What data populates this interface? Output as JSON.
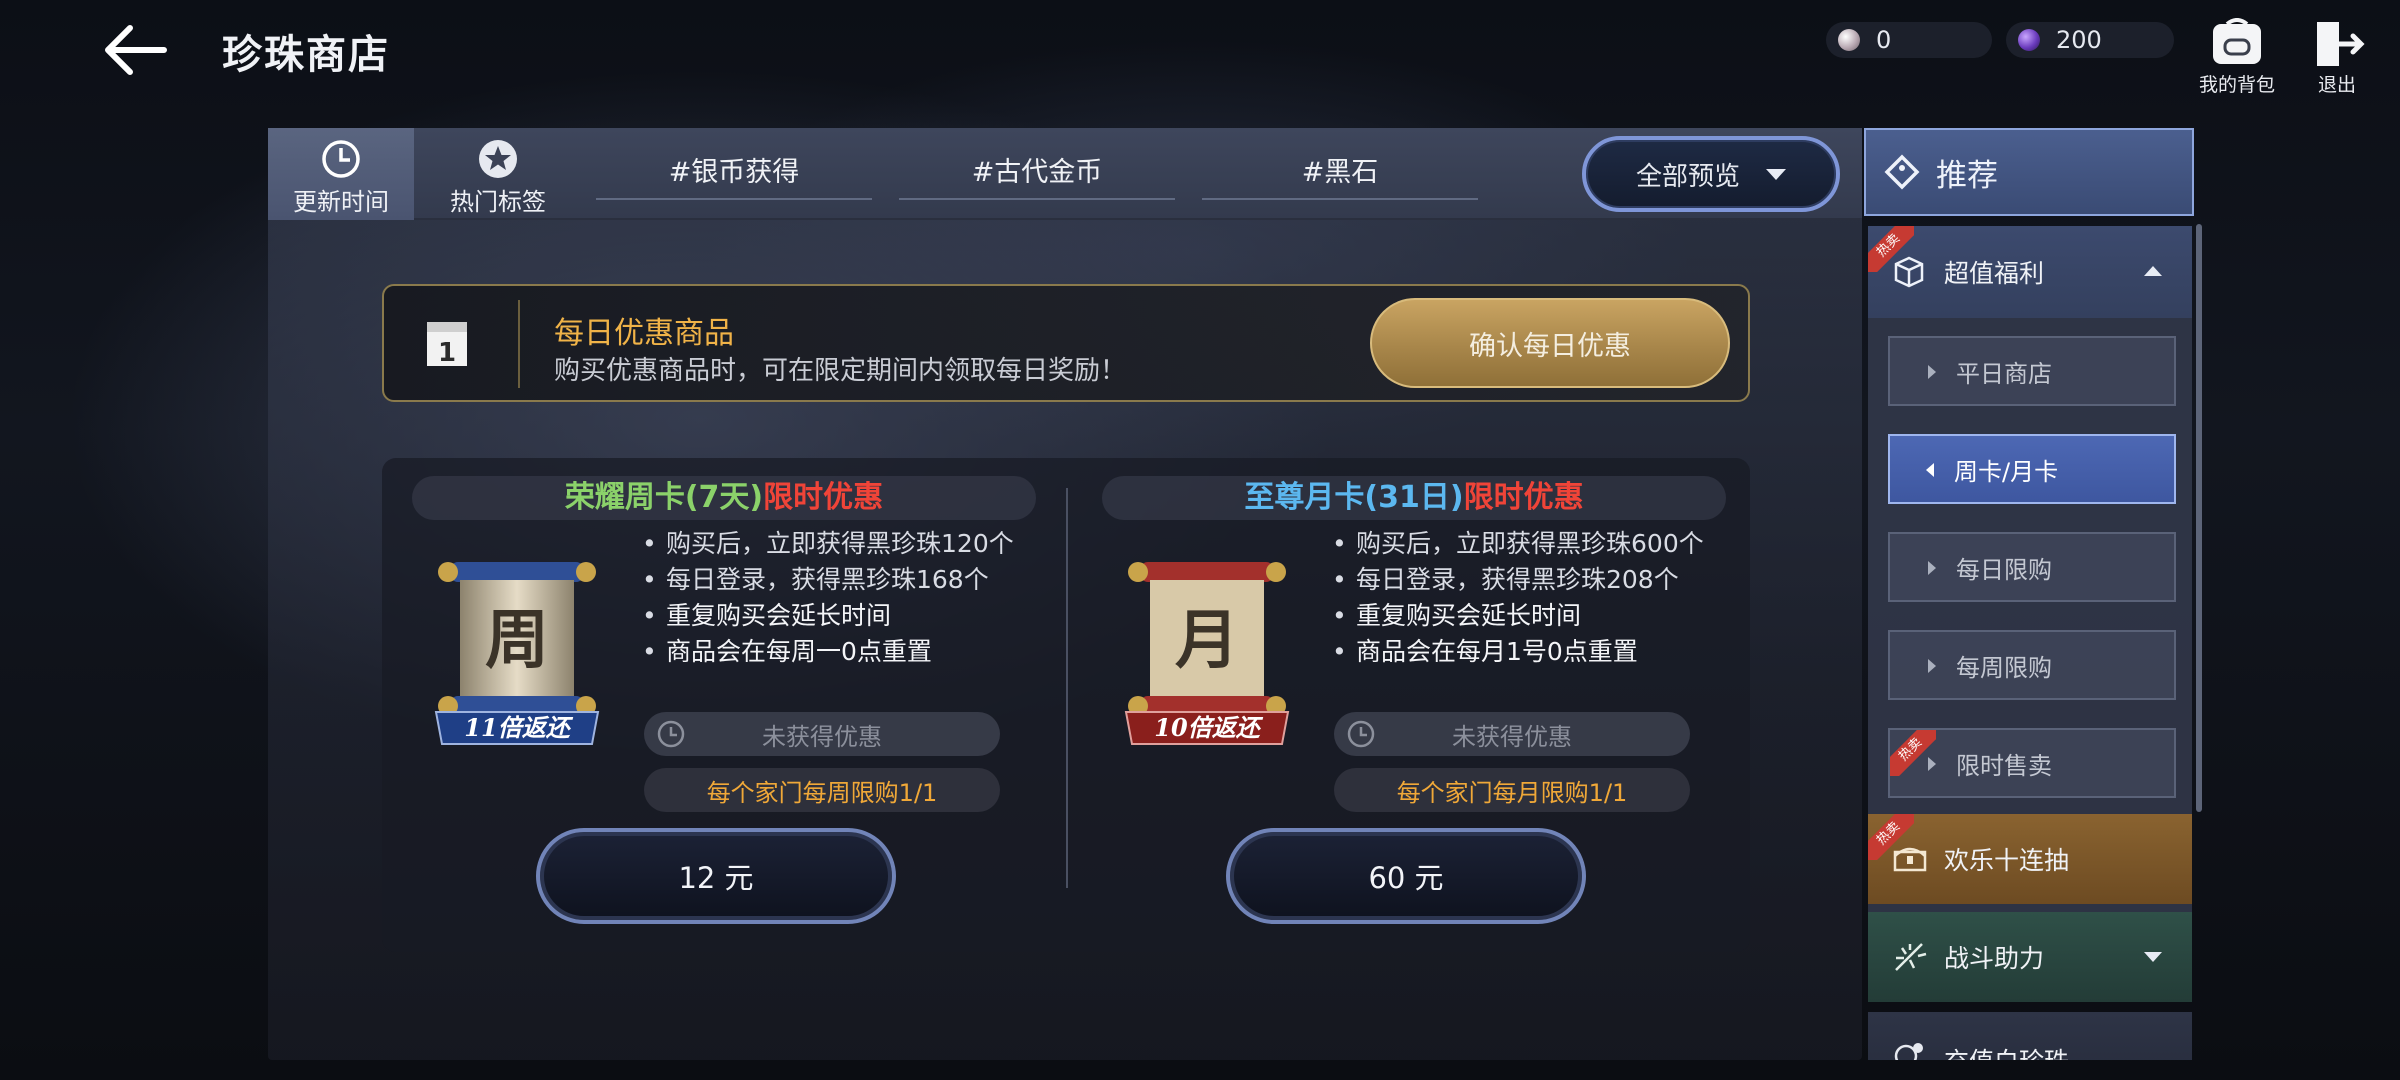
{
  "header": {
    "title": "珍珠商店",
    "back_icon": "arrow-left-icon",
    "currencies": [
      {
        "icon": "white-pearl-icon",
        "value": "0"
      },
      {
        "icon": "black-pearl-icon",
        "value": "200"
      }
    ],
    "bag_label": "我的背包",
    "exit_label": "退出"
  },
  "tabs": {
    "update_time": "更新时间",
    "hot_tags": "热门标签",
    "hashtags": [
      "#银币获得",
      "#古代金币",
      "#黑石"
    ],
    "preview_label": "全部预览"
  },
  "daily": {
    "title": "每日优惠商品",
    "description": "购买优惠商品时，可在限定期间内领取每日奖励！",
    "button_label": "确认每日优惠"
  },
  "offers": [
    {
      "title_main": "荣耀周卡(7天)",
      "title_highlight": "限时优惠",
      "scroll_char": "周",
      "return_badge": "11倍返还",
      "bullets": [
        "购买后，立即获得黑珍珠120个",
        "每日登录，获得黑珍珠168个",
        "重复购买会延长时间",
        "商品会在每周一0点重置"
      ],
      "status": "未获得优惠",
      "limit": "每个家门每周限购1/1",
      "price": "12 元"
    },
    {
      "title_main": "至尊月卡(31日)",
      "title_highlight": "限时优惠",
      "scroll_char": "月",
      "return_badge": "10倍返还",
      "bullets": [
        "购买后，立即获得黑珍珠600个",
        "每日登录，获得黑珍珠208个",
        "重复购买会延长时间",
        "商品会在每月1号0点重置"
      ],
      "status": "未获得优惠",
      "limit": "每个家门每月限购1/1",
      "price": "60 元"
    }
  ],
  "sidebar": {
    "recommend": "推荐",
    "hot_tag": "热卖",
    "categories": {
      "super": "超值福利",
      "happy": "欢乐十连抽",
      "battle": "战斗助力",
      "recharge": "充值白珍珠"
    },
    "sub_items": [
      "平日商店",
      "周卡/月卡",
      "每日限购",
      "每周限购",
      "限时售卖"
    ],
    "active_sub": "周卡/月卡"
  }
}
